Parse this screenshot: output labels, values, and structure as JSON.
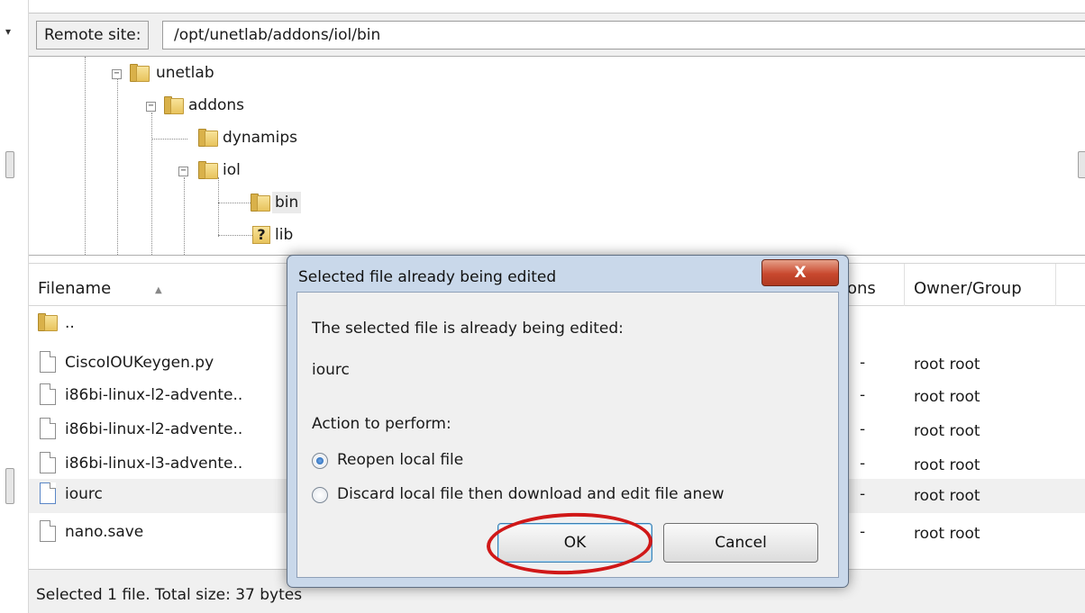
{
  "remote_site": {
    "label": "Remote site:",
    "path": "/opt/unetlab/addons/iol/bin"
  },
  "tree": {
    "nodes": [
      {
        "name": "unetlab",
        "expanded": true
      },
      {
        "name": "addons",
        "expanded": true
      },
      {
        "name": "dynamips",
        "expanded": false
      },
      {
        "name": "iol",
        "expanded": true
      },
      {
        "name": "bin",
        "selected": true
      },
      {
        "name": "lib",
        "unknown": true
      }
    ],
    "expanded_symbol": "−",
    "unknown_symbol": "?"
  },
  "file_list": {
    "columns": {
      "filename": "Filename",
      "permissions": "ons",
      "owner": "Owner/Group"
    },
    "rows": [
      {
        "name": "..",
        "perm": "",
        "owner": ""
      },
      {
        "name": "CiscoIOUKeygen.py",
        "perm": "-",
        "owner": "root root"
      },
      {
        "name": "i86bi-linux-l2-advente..",
        "perm": "-",
        "owner": "root root"
      },
      {
        "name": "i86bi-linux-l2-advente..",
        "perm": "-",
        "owner": "root root"
      },
      {
        "name": "i86bi-linux-l3-advente..",
        "perm": "-",
        "owner": "root root"
      },
      {
        "name": "iourc",
        "perm": "-",
        "owner": "root root",
        "selected": true
      },
      {
        "name": "nano.save",
        "perm": "-",
        "owner": "root root"
      }
    ]
  },
  "status": {
    "text": "Selected 1 file. Total size: 37 bytes"
  },
  "dialog": {
    "title": "Selected file already being edited",
    "close_label": "X",
    "message": "The selected file is already being edited:",
    "filename": "iourc",
    "action_label": "Action to perform:",
    "options": [
      {
        "label": "Reopen local file",
        "checked": true
      },
      {
        "label": "Discard local file then download and edit file anew",
        "checked": false
      }
    ],
    "ok_label": "OK",
    "cancel_label": "Cancel"
  },
  "colors": {
    "annotation_ellipse": "#d01818",
    "dialog_frame": "#c9d8ea",
    "close_button": "#c8482e"
  }
}
